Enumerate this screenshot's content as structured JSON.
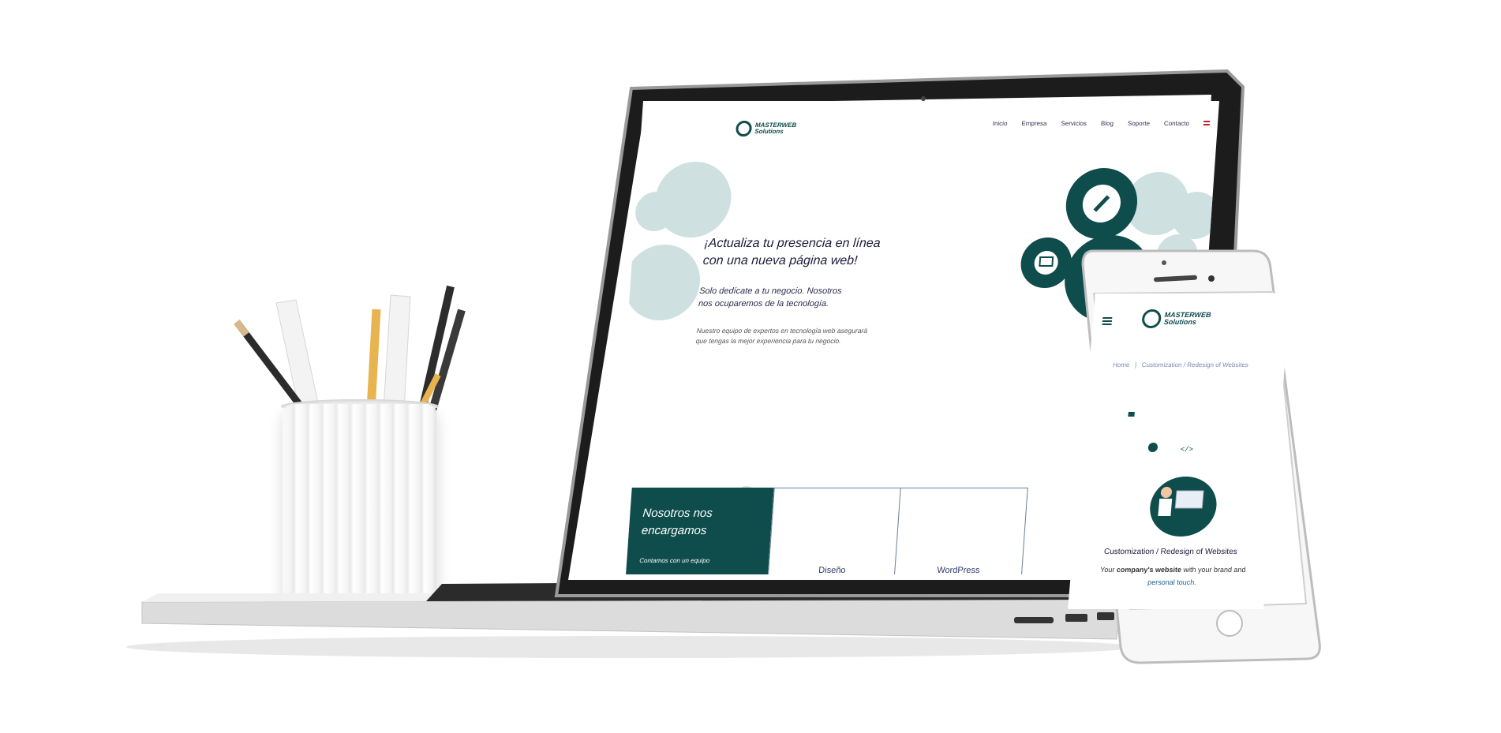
{
  "laptop_site": {
    "logo": {
      "line1": "MASTERWEB",
      "line2": "Solutions"
    },
    "nav": [
      "Inicio",
      "Empresa",
      "Servicios",
      "Blog",
      "Soporte",
      "Contacto"
    ],
    "hero": {
      "title": "¡Actualiza tu presencia en línea con una nueva página web!",
      "subtitle": "Solo dedícate a tu negocio. Nosotros nos ocuparemos de la tecnología.",
      "body": "Nuestro equipo de expertos en tecnología web asegurará que tengas la mejor experiencia para tu negocio."
    },
    "cards": {
      "green_title": "Nosotros nos encargamos",
      "green_sub": "Contamos con un equipo",
      "card1": "Diseño",
      "card2": "WordPress"
    }
  },
  "phone_site": {
    "logo": {
      "line1": "MASTERWEB",
      "line2": "Solutions"
    },
    "breadcrumb": {
      "home": "Home",
      "sep": "|",
      "current": "Customization / Redesign of Websites"
    },
    "service_title": "Customization / Redesign of Websites",
    "service_text_a": "Your ",
    "service_text_b": "company's website",
    "service_text_c": " with your brand and",
    "service_text_accent": "personal touch."
  },
  "colors": {
    "brand_teal": "#0f4c4c",
    "gear_light": "#cfe0e0"
  }
}
